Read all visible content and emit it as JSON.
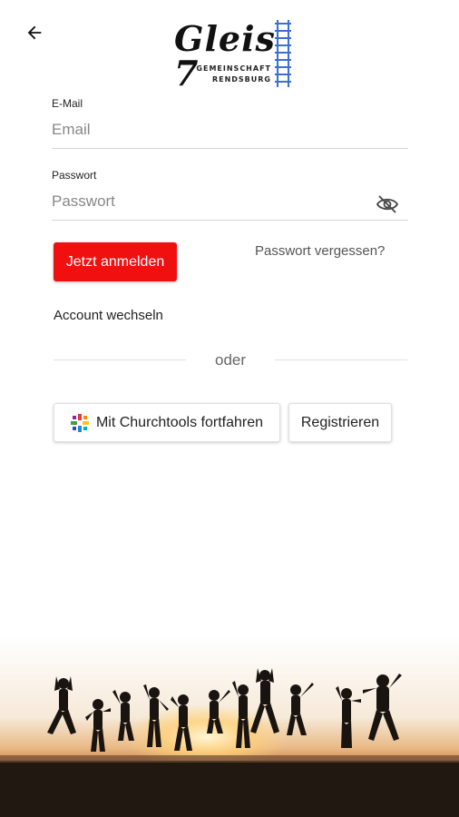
{
  "header": {
    "back_icon": "arrow-left-icon",
    "logo": {
      "script_text": "Gleis 7",
      "line1": "GEMEINSCHAFT",
      "line2": "RENDSBURG",
      "track_color": "#3b6fd1"
    }
  },
  "form": {
    "email": {
      "label": "E-Mail",
      "placeholder": "Email"
    },
    "password": {
      "label": "Passwort",
      "placeholder": "Passwort",
      "toggle_icon": "eye-off-icon"
    },
    "login_label": "Jetzt anmelden",
    "forgot_label": "Passwort vergessen?",
    "switch_account_label": "Account wechseln",
    "divider_text": "oder",
    "churchtools_label": "Mit Churchtools fortfahren",
    "churchtools_icon": "churchtools-logo-icon",
    "register_label": "Registrieren"
  },
  "colors": {
    "primary_button": "#f01010",
    "track": "#3b6fd1"
  },
  "footer_image": "silhouettes-jumping-at-sunset"
}
